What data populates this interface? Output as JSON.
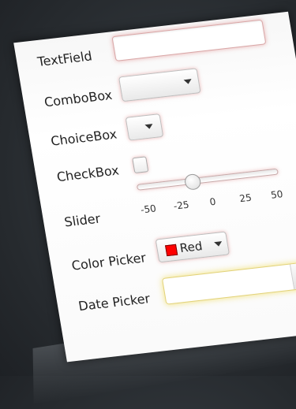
{
  "controls": {
    "textfield": {
      "label": "TextField",
      "value": ""
    },
    "combobox": {
      "label": "ComboBox",
      "value": ""
    },
    "choicebox": {
      "label": "ChoiceBox",
      "value": ""
    },
    "checkbox": {
      "label": "CheckBox",
      "checked": false
    },
    "slider": {
      "label": "Slider",
      "min": -50,
      "max": 50,
      "value": -11,
      "ticks": [
        "-50",
        "-25",
        "0",
        "25",
        "50"
      ]
    },
    "color_picker": {
      "label": "Color Picker",
      "value": "Red",
      "color": "#ff0000"
    },
    "date_picker": {
      "label": "Date Picker",
      "value": ""
    }
  },
  "colors": {
    "focus_glow": "#e08080",
    "date_focus_glow": "#f0dc5a",
    "background": "#2a2e32"
  },
  "icons": {
    "combo_arrow": "chevron-down-icon",
    "calendar": "calendar-icon"
  }
}
